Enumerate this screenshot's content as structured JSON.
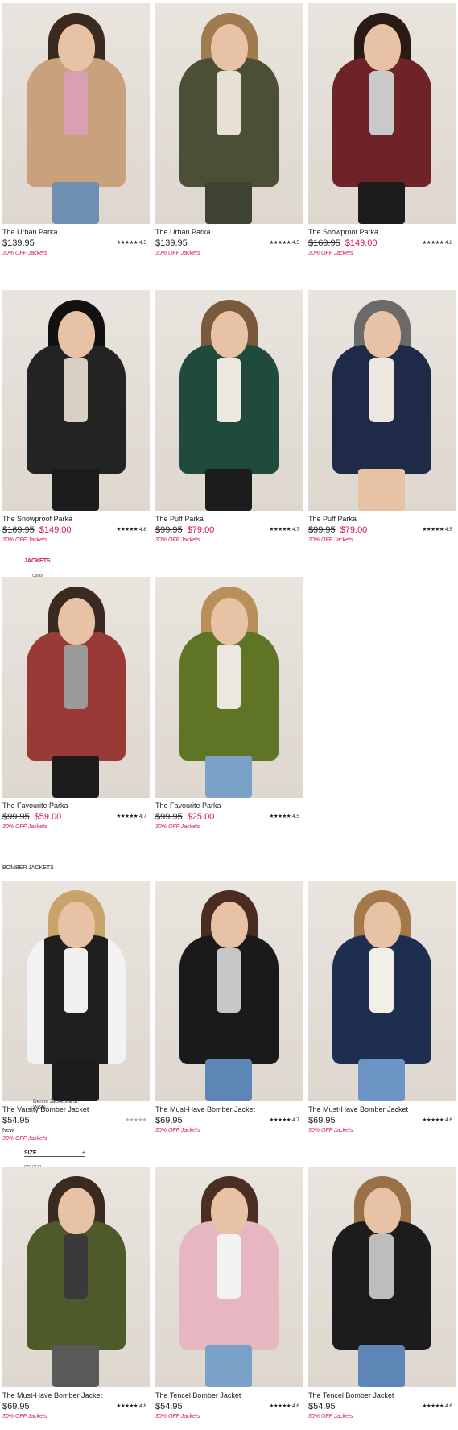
{
  "nav": {
    "jackets_link": "JACKETS",
    "jackets_sub": "Coats",
    "size_filter": "SIZE",
    "size_plus": "+",
    "colour_filter": "COLOUR",
    "denim_link_line1": "Denim Jackets and",
    "denim_link_line2": "Vests"
  },
  "section": {
    "bomber_title": "BOMBER JACKETS"
  },
  "colors": {
    "accent": "#d6135f"
  },
  "products": [
    {
      "name": "The Urban Parka",
      "price": "$139.95",
      "rating": "4.5",
      "promo": "30% OFF Jackets",
      "coat": "#c9a27d",
      "hair": "#3b2a20",
      "legs": "#6f8fb3",
      "shirt": "#d99fb2"
    },
    {
      "name": "The Urban Parka",
      "price": "$139.95",
      "rating": "4.5",
      "promo": "30% OFF Jackets",
      "coat": "#4a4f36",
      "hair": "#a07b4e",
      "legs": "#3f4432",
      "shirt": "#e8e2d6"
    },
    {
      "name": "The Snowproof Parka",
      "old_price": "$169.95",
      "price": "$149.00",
      "rating": "4.8",
      "promo": "30% OFF Jackets",
      "coat": "#6e2328",
      "hair": "#2a1a14",
      "legs": "#1c1c1c",
      "shirt": "#c9c9c9"
    },
    {
      "name": "The Snowproof Parka",
      "old_price": "$169.95",
      "price": "$149.00",
      "rating": "4.8",
      "promo": "30% OFF Jackets",
      "coat": "#232323",
      "hair": "#111111",
      "legs": "#1c1c1c",
      "shirt": "#d8cfc3"
    },
    {
      "name": "The Puff Parka",
      "old_price": "$99.95",
      "price": "$79.00",
      "rating": "4.7",
      "promo": "30% OFF Jackets",
      "coat": "#1f4a3c",
      "hair": "#7a5a3c",
      "legs": "#1c1c1c",
      "shirt": "#ece8df"
    },
    {
      "name": "The Puff Parka",
      "old_price": "$99.95",
      "price": "$79.00",
      "rating": "4.5",
      "promo": "30% OFF Jackets",
      "coat": "#1f2a48",
      "hair": "#6a6a6a",
      "legs": "#e7c2a5",
      "shirt": "#ece8df"
    },
    {
      "name": "The Favourite Parka",
      "old_price": "$99.95",
      "price": "$59.00",
      "rating": "4.7",
      "promo": "30% OFF Jackets",
      "coat": "#9a3a36",
      "hair": "#3a2a22",
      "legs": "#1c1c1c",
      "shirt": "#9a9a9a"
    },
    {
      "name": "The Favourite Parka",
      "old_price": "$99.95",
      "price": "$25.00",
      "rating": "4.5",
      "promo": "30% OFF Jackets",
      "coat": "#5f7425",
      "hair": "#b98f5a",
      "legs": "#7aa2c8",
      "shirt": "#ece8df"
    },
    {
      "name": "The Varsity Bomber Jacket",
      "price": "$54.95",
      "rating": "",
      "is_new": "New",
      "promo": "30% OFF Jackets",
      "coat": "#1f1f1f",
      "hair": "#c9a46a",
      "legs": "#1c1c1c",
      "shirt": "#f0f0f0"
    },
    {
      "name": "The Must-Have Bomber Jacket",
      "price": "$69.95",
      "rating": "4.7",
      "promo": "30% OFF Jackets",
      "coat": "#1a1a1a",
      "hair": "#4a2c20",
      "legs": "#5d86b6",
      "shirt": "#c7c7c7"
    },
    {
      "name": "The Must-Have Bomber Jacket",
      "price": "$69.95",
      "rating": "4.6",
      "promo": "30% OFF Jackets",
      "coat": "#1e2e50",
      "hair": "#a5784c",
      "legs": "#6c94c4",
      "shirt": "#f2efe9"
    },
    {
      "name": "The Must-Have Bomber Jacket",
      "price": "$69.95",
      "rating": "4.8",
      "promo": "30% OFF Jackets",
      "coat": "#4e5a2a",
      "hair": "#3b2a20",
      "legs": "#5a5a5a",
      "shirt": "#3a3a3a"
    },
    {
      "name": "The Tencel Bomber Jacket",
      "price": "$54.95",
      "rating": "4.6",
      "promo": "30% OFF Jackets",
      "coat": "#e6b7c0",
      "hair": "#4a2f22",
      "legs": "#7aa2c8",
      "shirt": "#f2f2f2"
    },
    {
      "name": "The Tencel Bomber Jacket",
      "price": "$54.95",
      "rating": "4.6",
      "promo": "30% OFF Jackets",
      "coat": "#1c1c1c",
      "hair": "#9a7048",
      "legs": "#5d86b6",
      "shirt": "#bdbdbd"
    }
  ]
}
